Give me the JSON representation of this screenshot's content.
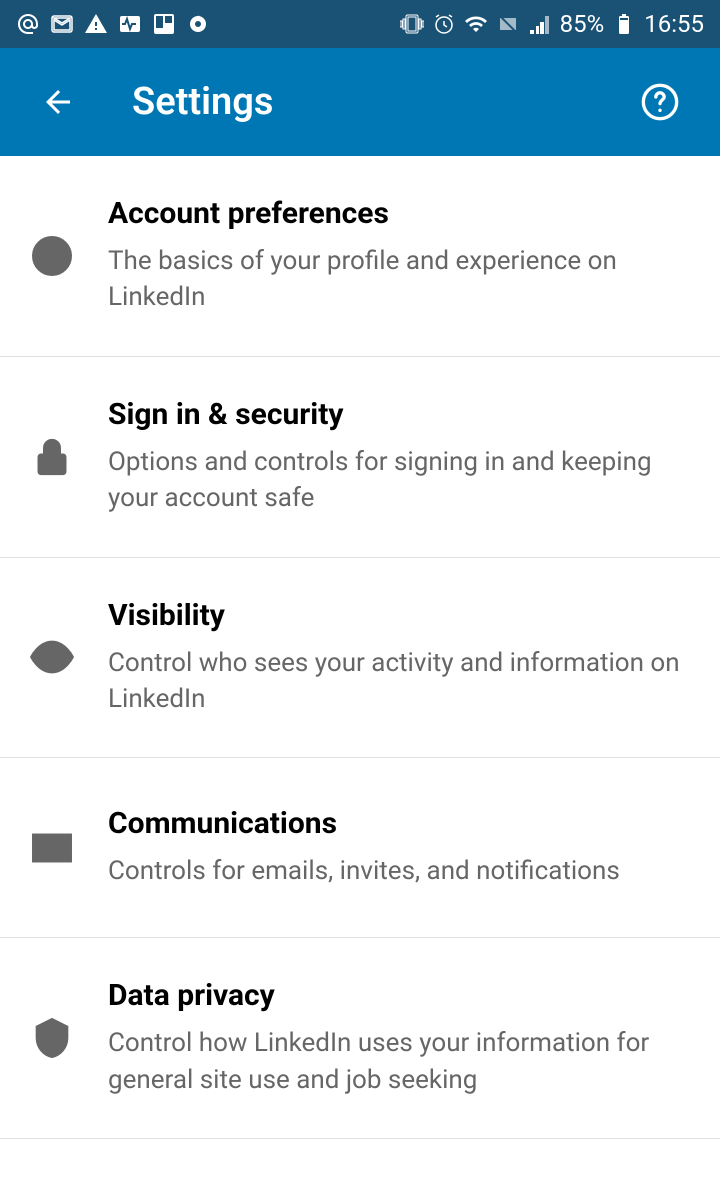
{
  "statusBar": {
    "battery": "85%",
    "time": "16:55"
  },
  "header": {
    "title": "Settings"
  },
  "settings": {
    "items": [
      {
        "title": "Account preferences",
        "description": "The basics of your profile and experience on LinkedIn"
      },
      {
        "title": "Sign in & security",
        "description": "Options and controls for signing in and keeping your account safe"
      },
      {
        "title": "Visibility",
        "description": "Control who sees your activity and information on LinkedIn"
      },
      {
        "title": "Communications",
        "description": "Controls for emails, invites, and notifications"
      },
      {
        "title": "Data privacy",
        "description": "Control how LinkedIn uses your information for general site use and job seeking"
      }
    ]
  }
}
